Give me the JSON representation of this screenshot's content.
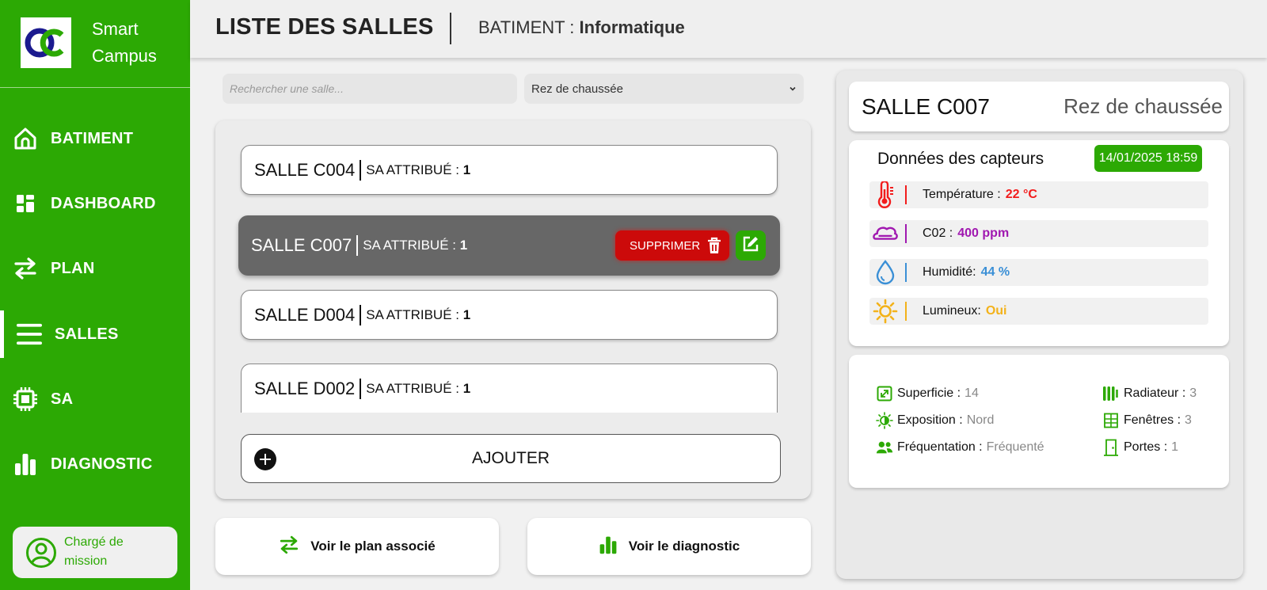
{
  "app": {
    "brand_line1": "Smart",
    "brand_line2": "Campus"
  },
  "sidebar": {
    "items": [
      {
        "label": "BATIMENT",
        "icon": "home-icon"
      },
      {
        "label": "DASHBOARD",
        "icon": "dashboard-icon"
      },
      {
        "label": "PLAN",
        "icon": "swap-arrows-icon"
      },
      {
        "label": "SALLES",
        "icon": "menu-lines-icon",
        "active": true
      },
      {
        "label": "SA",
        "icon": "chip-icon"
      },
      {
        "label": "DIAGNOSTIC",
        "icon": "bar-chart-icon"
      }
    ],
    "user": {
      "line1": "Chargé de",
      "line2": "mission",
      "icon": "user-circle-icon"
    }
  },
  "header": {
    "title": "LISTE DES SALLES",
    "building_label": "BATIMENT : ",
    "building_name": "Informatique"
  },
  "filters": {
    "search_placeholder": "Rechercher une salle...",
    "floor_selected": "Rez de chaussée"
  },
  "rooms": [
    {
      "name": "SALLE C004",
      "attr_label": "SA ATTRIBUÉ : ",
      "attr_value": "1"
    },
    {
      "name": "SALLE C007",
      "attr_label": "SA ATTRIBUÉ : ",
      "attr_value": "1",
      "selected": true
    },
    {
      "name": "SALLE D004",
      "attr_label": "SA ATTRIBUÉ : ",
      "attr_value": "1"
    },
    {
      "name": "SALLE D002",
      "attr_label": "SA ATTRIBUÉ : ",
      "attr_value": "1"
    }
  ],
  "row_actions": {
    "delete_label": "SUPPRIMER"
  },
  "add_label": "AJOUTER",
  "actions": {
    "plan_label": "Voir le plan associé",
    "diag_label": "Voir le diagnostic"
  },
  "detail": {
    "room_title": "SALLE C007",
    "floor": "Rez de chaussée",
    "sensors_title": "Données des capteurs",
    "date": "14/01/2025 18:59",
    "sensors": [
      {
        "label": "Température :",
        "value": "22 °C",
        "color": "#f21c1c",
        "icon": "thermometer-icon"
      },
      {
        "label": "C02 :",
        "value": "400 ppm",
        "color": "#a018b0",
        "icon": "cloud-icon"
      },
      {
        "label": "Humidité:",
        "value": "44 %",
        "color": "#3a8fd6",
        "icon": "droplet-icon"
      },
      {
        "label": "Lumineux:",
        "value": "Oui",
        "color": "#f3b21a",
        "icon": "sun-icon"
      }
    ],
    "props": {
      "superficie": {
        "label": "Superficie :",
        "value": "14"
      },
      "radiateur": {
        "label": "Radiateur :",
        "value": "3"
      },
      "exposition": {
        "label": "Exposition :",
        "value": "Nord"
      },
      "fenetres": {
        "label": "Fenêtres :",
        "value": "3"
      },
      "frequentation": {
        "label": "Fréquentation :",
        "value": "Fréquenté"
      },
      "portes": {
        "label": "Portes :",
        "value": "1"
      }
    }
  },
  "colors": {
    "brand_green": "#2ca904",
    "danger": "#cc0a0a",
    "selected_row": "#676767"
  }
}
